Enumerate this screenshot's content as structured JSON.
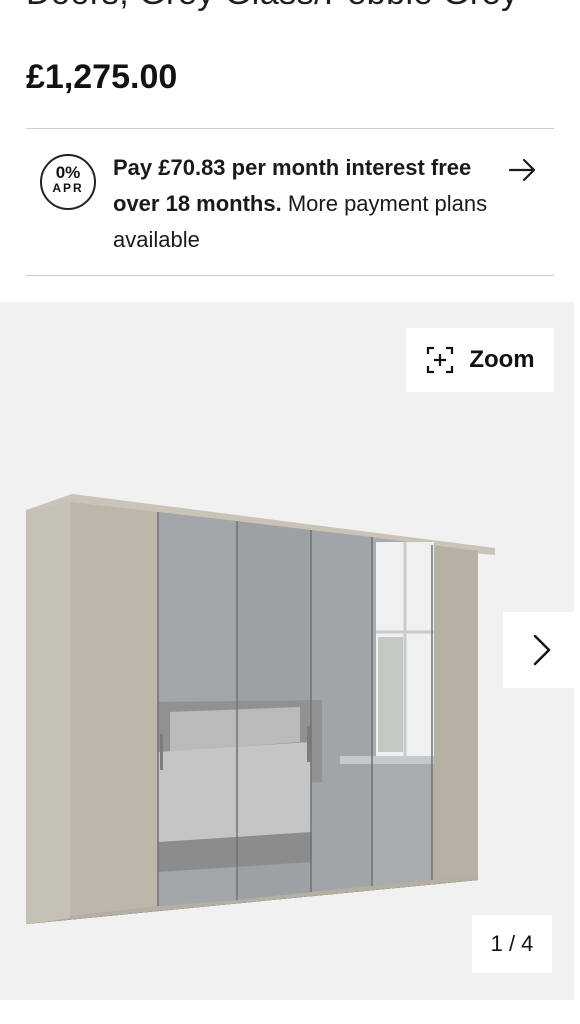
{
  "product": {
    "title_partial": "Doors, Grey Glass/Pebble Grey",
    "price": "£1,275.00"
  },
  "finance": {
    "badge_pct": "0%",
    "badge_apr": "APR",
    "text_bold": "Pay £70.83 per month interest free over 18 months.",
    "text_rest": " More payment plans available",
    "arrow_icon": "arrow-right-icon"
  },
  "gallery": {
    "image_alt": "Grey wardrobe with mirrored doors",
    "zoom_label": "Zoom",
    "zoom_icon": "zoom-expand-icon",
    "next_icon": "chevron-right-icon",
    "counter": "1 / 4"
  },
  "colors": {
    "text": "#121212",
    "divider": "#cfcfcf",
    "gallery_bg": "#f1f1f1",
    "wardrobe_body": "#bcb6aa",
    "mirror": "#9ea1a3"
  }
}
